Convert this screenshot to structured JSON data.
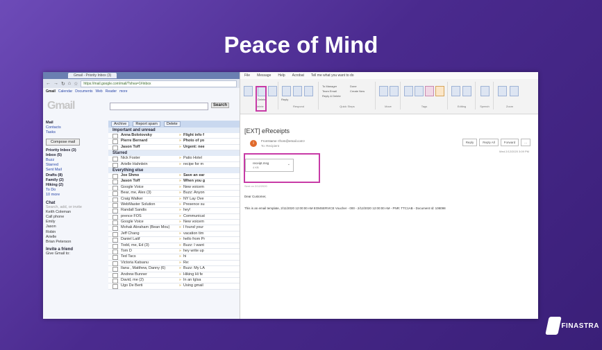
{
  "slide": {
    "title": "Peace of Mind",
    "brand": "FINASTRA"
  },
  "gmail": {
    "tab_title": "Gmail - Priority Inbox (3)",
    "url": "https://mail.google.com/mail/?shva=1#inbox",
    "top_links": [
      "Gmail",
      "Calendar",
      "Documents",
      "Web",
      "Reader",
      "more"
    ],
    "logo": "Gmail",
    "search_button": "Search",
    "nav_items": [
      {
        "label": "Mail",
        "bold": true
      },
      {
        "label": "Contacts",
        "bold": false
      },
      {
        "label": "Tasks",
        "bold": false
      }
    ],
    "compose_label": "Compose mail",
    "folders": [
      {
        "label": "Priority Inbox (3)",
        "bold": true
      },
      {
        "label": "Inbox (5)",
        "bold": true
      },
      {
        "label": "Buzz",
        "bold": false
      },
      {
        "label": "Starred",
        "bold": false
      },
      {
        "label": "Sent Mail",
        "bold": false
      },
      {
        "label": "Drafts (8)",
        "bold": true
      },
      {
        "label": "Family (2)",
        "bold": true
      },
      {
        "label": "Hiking (2)",
        "bold": true
      },
      {
        "label": "To Do",
        "bold": false
      },
      {
        "label": "10 more",
        "bold": false
      }
    ],
    "chat_header": "Chat",
    "chat_search_placeholder": "Search, add, or invite",
    "chat_contacts": [
      "Keith Coleman",
      "Call phone",
      "Emily",
      "Jason",
      "Robin",
      "Arielle",
      "Brian Peterson"
    ],
    "invite_header": "Invite a friend",
    "invite_text": "Give Gmail to:",
    "toolbar": [
      "Archive",
      "Report spam",
      "Delete"
    ],
    "sections": {
      "important": "Important and unread",
      "starred": "Starred",
      "everything": "Everything else"
    },
    "rows_important": [
      {
        "from": "Anna Bolotovsky",
        "subject": "Flight info f",
        "unread": true
      },
      {
        "from": "Pierre Bernard",
        "subject": "Photo of yo",
        "unread": true
      },
      {
        "from": "Jason Toff",
        "subject": "Urgent: nee",
        "unread": true
      }
    ],
    "rows_starred": [
      {
        "from": "Nick Foster",
        "subject": "Patio Hotel",
        "unread": false
      },
      {
        "from": "Arielle Hahnlein",
        "subject": "recipe for m",
        "unread": false
      }
    ],
    "rows_everything": [
      {
        "from": "Joe Shmo",
        "subject": "Save an ear",
        "unread": true
      },
      {
        "from": "Jason Toff",
        "subject": "When you g",
        "unread": true
      },
      {
        "from": "Google Voice",
        "subject": "New voicem",
        "unread": false
      },
      {
        "from": "Bear, me, Alex (3)",
        "subject": "Buzz: Anyon",
        "unread": false
      },
      {
        "from": "Craig Walker",
        "subject": "NY Lay Ove",
        "unread": false
      },
      {
        "from": "WebMaster Solution",
        "subject": "Presence su",
        "unread": false
      },
      {
        "from": "Randall Sandis",
        "subject": "hey!",
        "unread": false
      },
      {
        "from": "prence FOS",
        "subject": "Communicat",
        "unread": false
      },
      {
        "from": "Google Voice",
        "subject": "New voicem",
        "unread": false
      },
      {
        "from": "Mohak Abraham (Bean Mou)",
        "subject": "I found your",
        "unread": false
      },
      {
        "from": "Jeff Chang",
        "subject": "vacation tim",
        "unread": false
      },
      {
        "from": "Daniel Latif",
        "subject": "hello from Pr",
        "unread": false
      },
      {
        "from": "Todd, me, Ed (3)",
        "subject": "Buzz: I want",
        "unread": false
      },
      {
        "from": "Tom D",
        "subject": "hey write up",
        "unread": false
      },
      {
        "from": "Ted Tacs",
        "subject": "hi",
        "unread": false
      },
      {
        "from": "Victoria Katsanu",
        "subject": "Re:",
        "unread": false
      },
      {
        "from": "Ilana , Matthew, Danny (6)",
        "subject": "Buzz: My LA",
        "unread": false
      },
      {
        "from": "Andrew Bunner",
        "subject": "Hiking Hi fe",
        "unread": false
      },
      {
        "from": "David, me (2)",
        "subject": "In an Iglsa",
        "unread": false
      },
      {
        "from": "Ugo De Berti",
        "subject": "Using gmail",
        "unread": false
      }
    ]
  },
  "outlook": {
    "menu": [
      "File",
      "Message",
      "Help",
      "Acrobat",
      "Tell me what you want to do"
    ],
    "ribbon": {
      "delete_label": "Delete",
      "archive_label": "Archive",
      "reply_label": "Reply",
      "reply_all_label": "Reply All",
      "forward_label": "Forward",
      "groups": [
        "Delete",
        "Respond",
        "Quick Steps",
        "Move",
        "Tags",
        "Editing",
        "Speech",
        "Zoom"
      ],
      "quick_steps": [
        "To Manager",
        "Team Email",
        "Reply & Delete",
        "Done",
        "Create New"
      ]
    },
    "subject": "[EXT] eReceipts",
    "avatar_letter": "i",
    "from": "FromName <from@email.com>",
    "to": "To: Recipient",
    "buttons": [
      "Reply",
      "Reply All",
      "Forward",
      "..."
    ],
    "date": "Wed 2/12/2020 3:09 PM",
    "attachment": {
      "name": "receipt.msg",
      "size": "4 KB"
    },
    "tiny_line": "Sent on 2/12/2020",
    "greeting": "Dear Customer,",
    "body_text": "This is an email template, 2/11/2020 12:00:00 AM EOMSERVICE Voucher - 000 - 2/12/2020 12:00:00 AM - PNR: TTC1AB - Document Id: 108098"
  }
}
